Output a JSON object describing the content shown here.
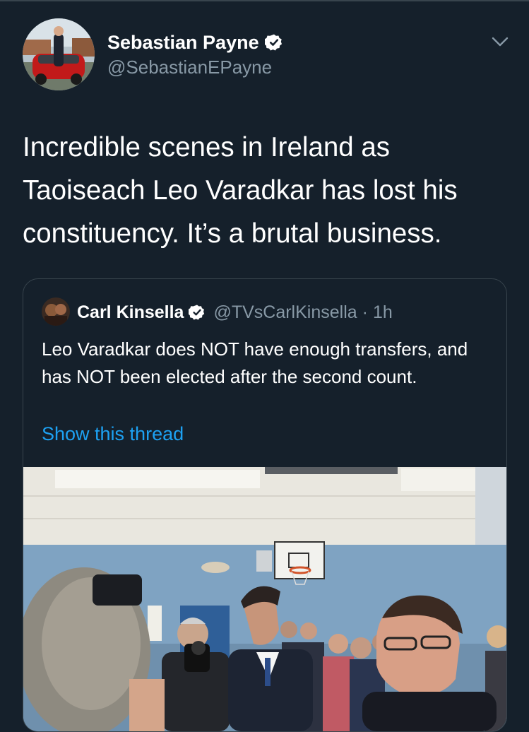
{
  "tweet": {
    "author_name": "Sebastian Payne",
    "author_handle": "@SebastianEPayne",
    "text": "Incredible scenes in Ireland as Taoiseach Leo Varadkar has lost his constituency. It’s a brutal business."
  },
  "quoted_tweet": {
    "author_name": "Carl Kinsella",
    "author_handle": "@TVsCarlKinsella",
    "separator": "·",
    "time": "1h",
    "text": "Leo Varadkar does NOT have enough transfers, and has NOT been elected after the second count.",
    "thread_link": "Show this thread"
  },
  "icons": {
    "verified": "verified-badge-icon",
    "menu": "chevron-down-icon"
  },
  "colors": {
    "background": "#15202b",
    "link": "#1da1f2",
    "secondary_text": "#8899a6",
    "border": "#38444d"
  }
}
